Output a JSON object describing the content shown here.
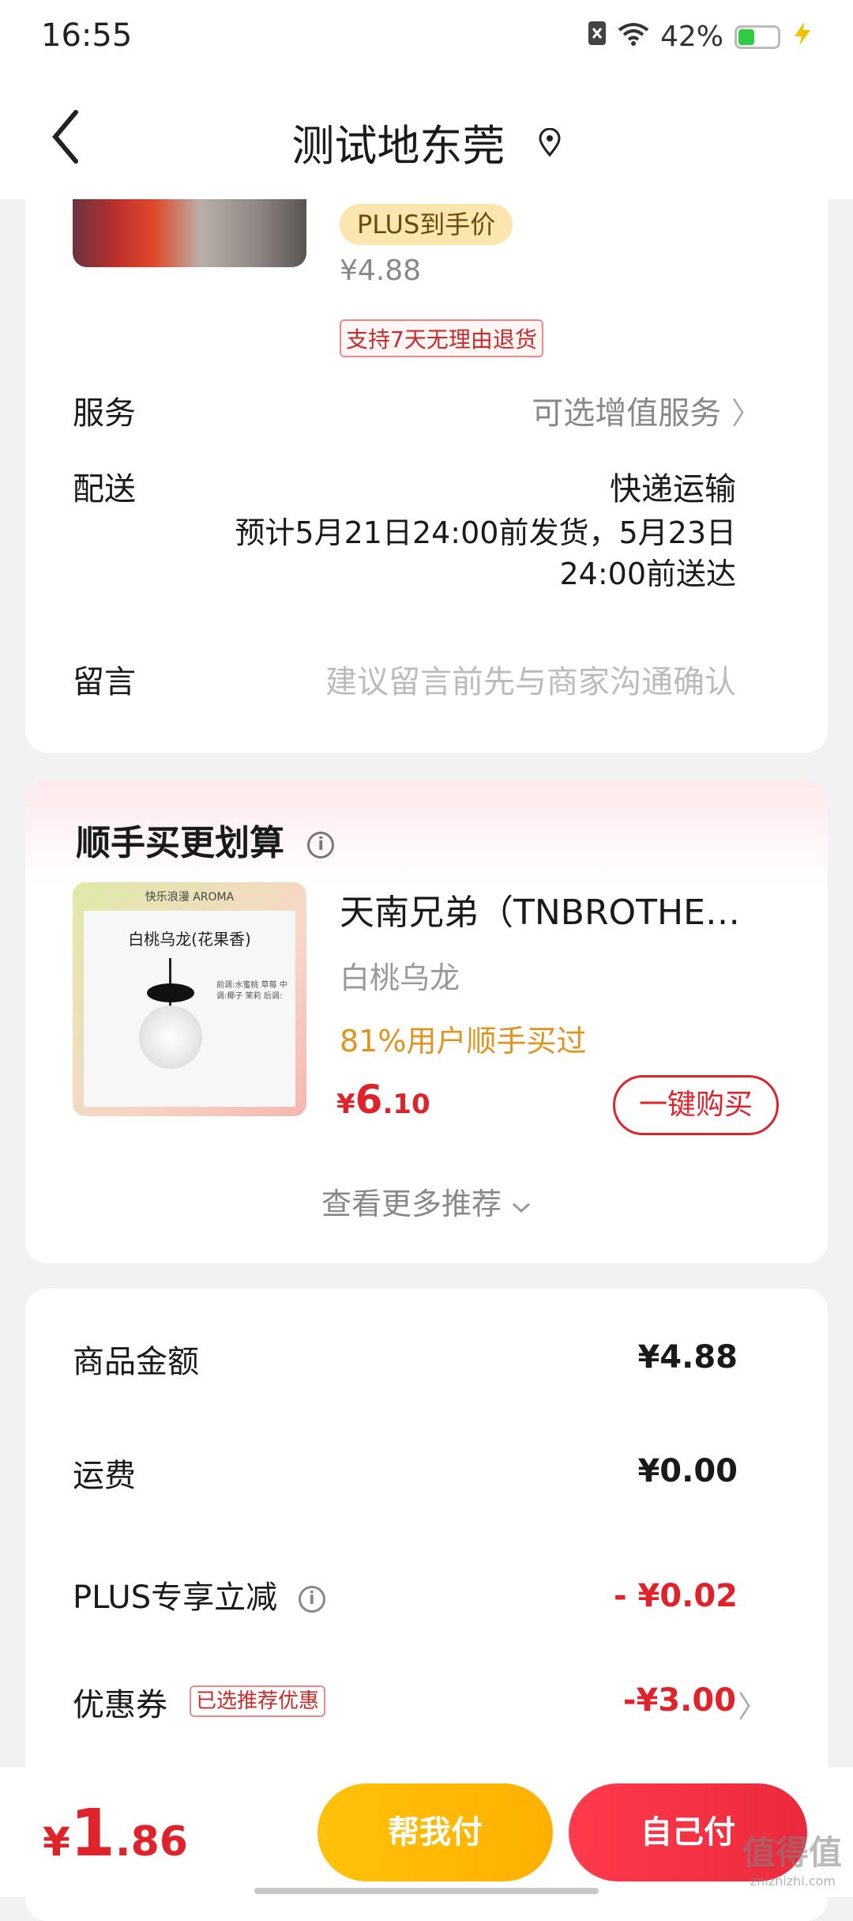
{
  "status_bar": {
    "time": "16:55",
    "battery_percent": "42%",
    "battery_level": 0.42
  },
  "header": {
    "title": "测试地东莞"
  },
  "product": {
    "plus_label": "PLUS到手价",
    "price": "¥4.88",
    "return_policy": "支持7天无理由退货"
  },
  "order_rows": {
    "service_label": "服务",
    "service_value": "可选增值服务",
    "delivery_label": "配送",
    "delivery_value": "快递运输",
    "delivery_eta": "预计5月21日24:00前发货，5月23日24:00前送达",
    "message_label": "留言",
    "message_placeholder": "建议留言前先与商家沟通确认"
  },
  "recommend": {
    "title": "顺手买更划算",
    "image_header": "快乐浪漫 AROMA",
    "image_title": "白桃乌龙(花果香)",
    "image_notes": "前调:水蜜桃 草莓 中调:椰子 茉莉 后调:",
    "name": "天南兄弟（TNBROTHE…",
    "variant": "白桃乌龙",
    "rate": "81%用户顺手买过",
    "price_currency": "¥",
    "price_int": "6",
    "price_dec": ".10",
    "buy_label": "一键购买",
    "more_label": "查看更多推荐"
  },
  "summary": {
    "goods_label": "商品金额",
    "goods_value": "¥4.88",
    "shipping_label": "运费",
    "shipping_value": "¥0.00",
    "plus_label": "PLUS专享立减",
    "plus_value": "- ¥0.02",
    "coupon_label": "优惠券",
    "coupon_tag": "已选推荐优惠",
    "coupon_value": "-¥3.00"
  },
  "bottom": {
    "currency": "¥",
    "total_int": "1",
    "total_dec": ".86",
    "help_pay": "帮我付",
    "self_pay": "自己付"
  },
  "watermark": {
    "text": "值得值",
    "sub": "zhizhizhi.com"
  },
  "colors": {
    "accent_red": "#e0222b",
    "accent_yellow": "#ffc20a",
    "plus_gold": "#fbe6b0"
  }
}
